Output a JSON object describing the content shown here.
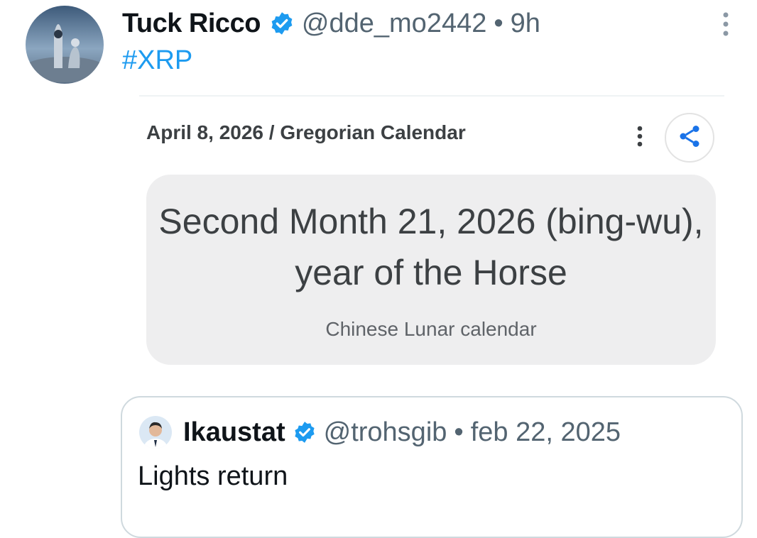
{
  "post": {
    "display_name": "Tuck Ricco",
    "handle": "@dde_mo2442",
    "separator": "•",
    "time": "9h",
    "hashtag": "#XRP"
  },
  "calendar_card": {
    "gregorian": "April 8, 2026 / Gregorian Calendar",
    "lunar_date": "Second Month 21, 2026 (bing-wu), year of the Horse",
    "lunar_label": "Chinese Lunar calendar"
  },
  "quoted_post": {
    "display_name": "Ikaustat",
    "handle": "@trohsgib",
    "separator": "•",
    "date": "feb 22, 2025",
    "text": "Lights return"
  },
  "colors": {
    "verified": "#1d9bf0",
    "hashtag": "#1d9bf0",
    "share_icon": "#1a73e8"
  },
  "icons": [
    "verified-badge-icon",
    "more-vertical-icon",
    "share-icon"
  ]
}
